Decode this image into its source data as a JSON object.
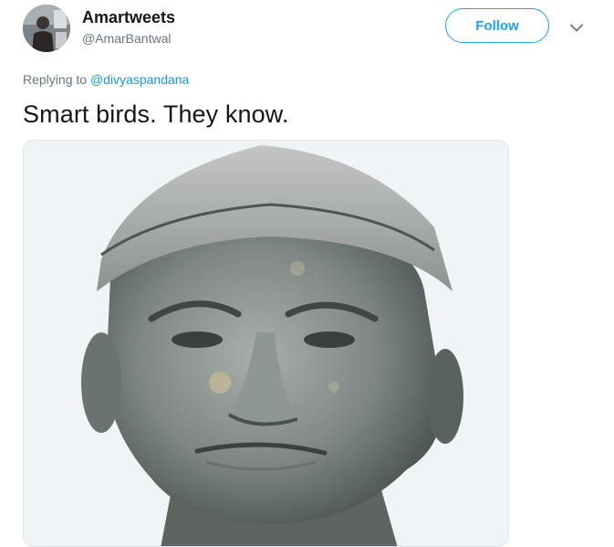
{
  "user": {
    "display_name": "Amartweets",
    "handle": "@AmarBantwal",
    "avatar_icon": "user-avatar"
  },
  "follow_button": {
    "label": "Follow"
  },
  "menu": {
    "icon": "chevron-down-icon"
  },
  "reply": {
    "prefix": "Replying to",
    "mention": "@divyaspandana"
  },
  "tweet": {
    "text": "Smart birds. They know."
  },
  "media": {
    "type": "image",
    "subject": "statue-bust-photo"
  },
  "colors": {
    "accent": "#1da1f2",
    "link": "#1b95e0",
    "secondary_text": "#657786",
    "primary_text": "#14171a",
    "border": "#e1e8ed"
  }
}
